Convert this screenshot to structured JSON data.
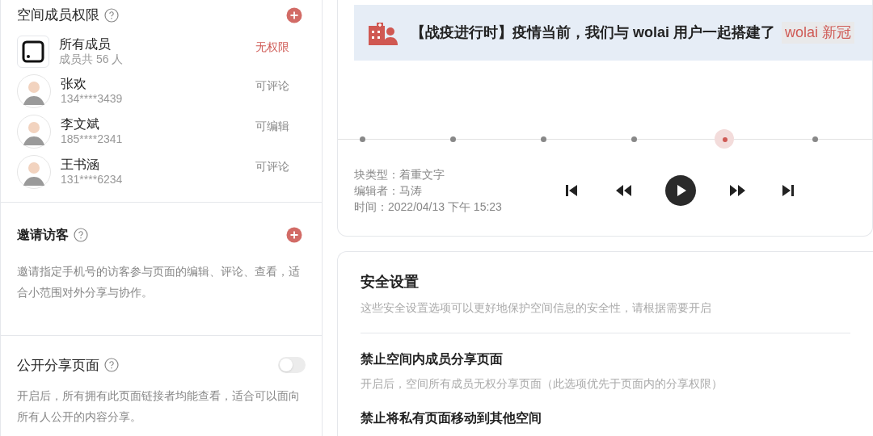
{
  "members": {
    "title": "空间成员权限",
    "items": [
      {
        "kind": "group",
        "name": "所有成员",
        "sub": "成员共 56 人",
        "permission": "无权限",
        "highlight": true
      },
      {
        "kind": "person",
        "name": "张欢",
        "sub": "134****3439",
        "permission": "可评论",
        "highlight": false
      },
      {
        "kind": "person",
        "name": "李文斌",
        "sub": "185****2341",
        "permission": "可编辑",
        "highlight": false
      },
      {
        "kind": "person",
        "name": "王书涵",
        "sub": "131****6234",
        "permission": "可评论",
        "highlight": false
      }
    ]
  },
  "guests": {
    "title": "邀请访客",
    "description": "邀请指定手机号的访客参与页面的编辑、评论、查看，适合小范围对外分享与协作。"
  },
  "public_share": {
    "title": "公开分享页面",
    "on": false,
    "description": "开启后，所有拥有此页面链接者均能查看，适合可以面向所有人公开的内容分享。"
  },
  "banner": {
    "text": "【战疫进行时】疫情当前，我们与 wolai 用户一起搭建了",
    "link": "wolai 新冠"
  },
  "timeline": [
    {
      "selected": false
    },
    {
      "selected": false
    },
    {
      "selected": false
    },
    {
      "selected": false
    },
    {
      "selected": true
    },
    {
      "selected": false
    }
  ],
  "block_info": [
    "块类型：着重文字",
    "编辑者：马涛",
    "时间：2022/04/13 下午 15:23"
  ],
  "security": {
    "title": "安全设置",
    "subtitle": "这些安全设置选项可以更好地保护空间信息的安全性，请根据需要开启",
    "options": [
      {
        "title": "禁止空间内成员分享页面",
        "description": "开启后，空间所有成员无权分享页面（此选项优先于页面内的分享权限）"
      },
      {
        "title": "禁止将私有页面移动到其他空间"
      }
    ]
  }
}
